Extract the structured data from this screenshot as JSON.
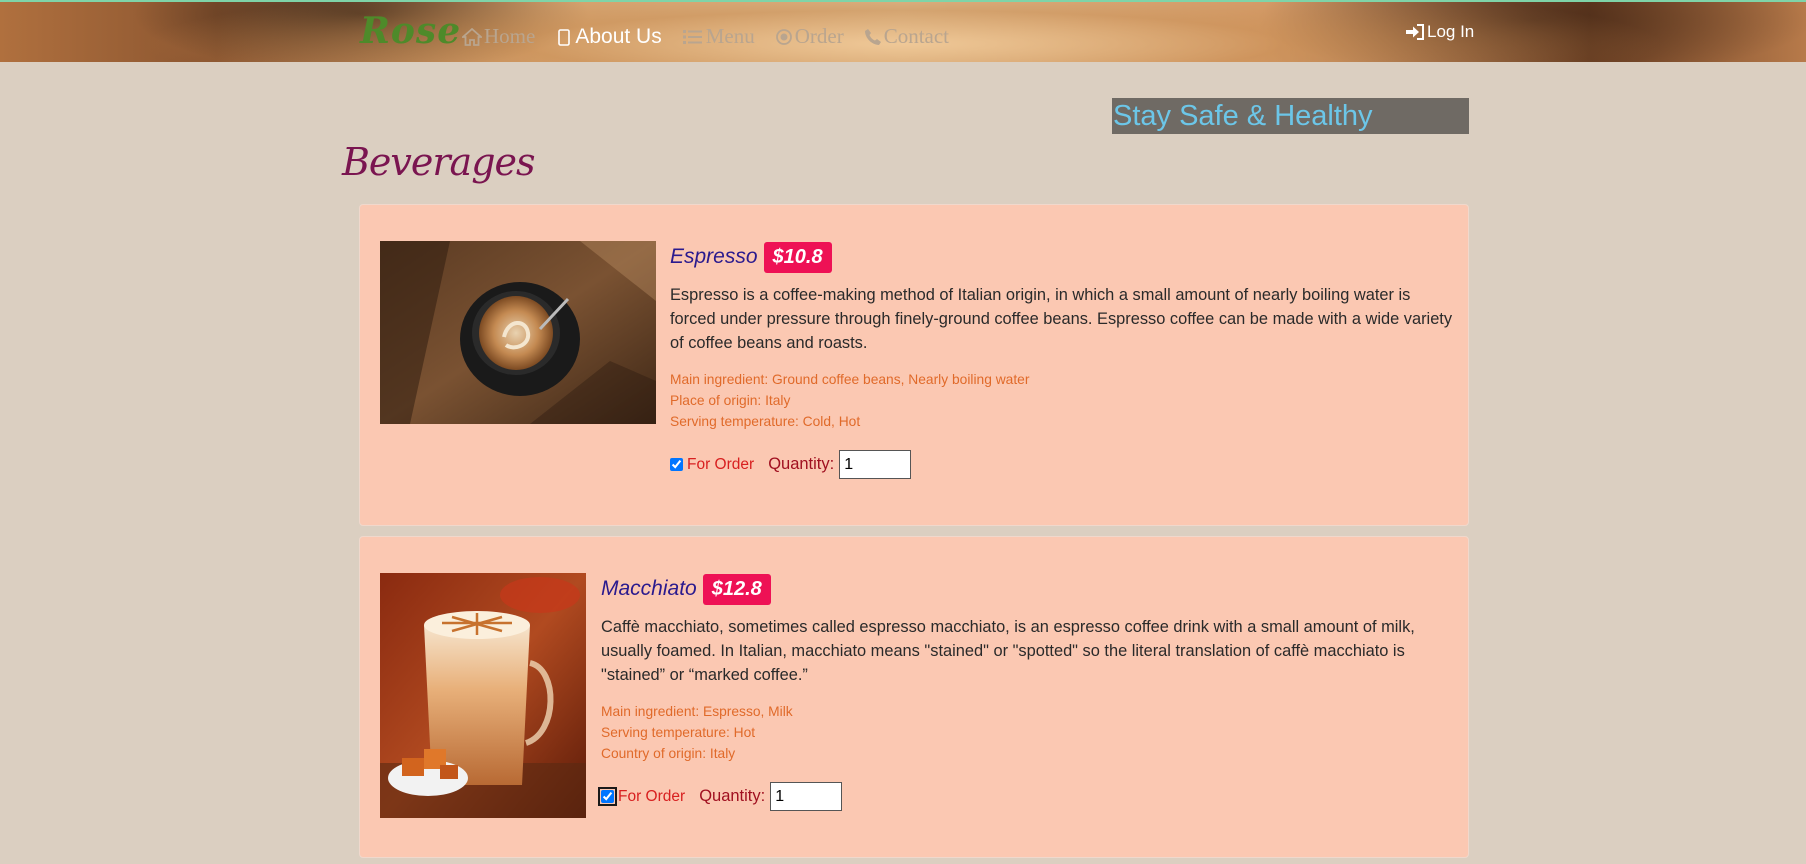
{
  "brand": "Rose",
  "nav": {
    "items": [
      {
        "label": "Home",
        "icon": "home-icon"
      },
      {
        "label": "About Us",
        "icon": "mobile-icon"
      },
      {
        "label": "Menu",
        "icon": "list-icon"
      },
      {
        "label": "Order",
        "icon": "dot-circle-icon"
      },
      {
        "label": "Contact",
        "icon": "phone-icon"
      }
    ],
    "active": "About Us",
    "login": "Log In"
  },
  "banner": "Stay Safe & Healthy",
  "section_title": "Beverages",
  "items": [
    {
      "name": "Espresso",
      "price": "$10.8",
      "description": "Espresso is a coffee-making method of Italian origin, in which a small amount of nearly boiling water is forced under pressure through finely-ground coffee beans. Espresso coffee can be made with a wide variety of coffee beans and roasts.",
      "facts": [
        "Main ingredient: Ground coffee beans, Nearly boiling water",
        "Place of origin: Italy",
        "Serving temperature: Cold, Hot"
      ],
      "for_order_label": "For Order",
      "for_order_checked": true,
      "quantity_label": "Quantity:",
      "quantity": "1"
    },
    {
      "name": "Macchiato",
      "price": "$12.8",
      "description": "Caffè macchiato, sometimes called espresso macchiato, is an espresso coffee drink with a small amount of milk, usually foamed. In Italian, macchiato means \"stained\" or \"spotted\" so the literal translation of caffè macchiato is \"stained” or “marked coffee.”",
      "facts": [
        "Main ingredient: Espresso, Milk",
        "Serving temperature: Hot",
        "Country of origin: Italy"
      ],
      "for_order_label": "For Order",
      "for_order_checked": true,
      "quantity_label": "Quantity:",
      "quantity": "1"
    }
  ],
  "colors": {
    "page_bg": "#dbcfc1",
    "card_bg": "#fbc8b2",
    "price_badge": "#ee1155",
    "item_name": "#2a1a8e",
    "facts": "#e06a2a",
    "section_title": "#7a1550",
    "banner_text": "#6cc6e8",
    "banner_bg": "#6f6a64",
    "brand": "#4e8a2a"
  }
}
